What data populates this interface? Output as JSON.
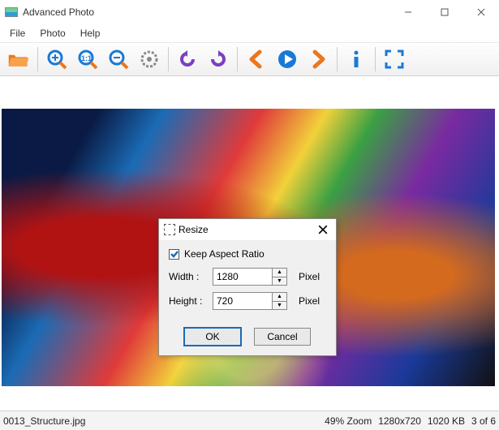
{
  "window": {
    "title": "Advanced Photo"
  },
  "menu": {
    "items": [
      "File",
      "Photo",
      "Help"
    ]
  },
  "toolbar": {
    "open": "open-folder",
    "zoom_in": "zoom-in",
    "zoom_actual": "zoom-actual",
    "zoom_out": "zoom-out",
    "zoom_fit": "zoom-fit",
    "rotate_ccw": "rotate-left",
    "rotate_cw": "rotate-right",
    "prev": "previous",
    "play": "play",
    "next": "next",
    "info": "info",
    "fullscreen": "fullscreen"
  },
  "colors": {
    "accent_blue": "#1a79d4",
    "accent_orange": "#eb771e",
    "accent_purple": "#7b3fbf"
  },
  "dialog": {
    "title": "Resize",
    "keep_ratio_label": "Keep Aspect Ratio",
    "keep_ratio_checked": true,
    "width_label": "Width :",
    "width_value": "1280",
    "width_unit": "Pixel",
    "height_label": "Height :",
    "height_value": "720",
    "height_unit": "Pixel",
    "ok_label": "OK",
    "cancel_label": "Cancel"
  },
  "status": {
    "filename": "0013_Structure.jpg",
    "zoom": "49% Zoom",
    "dimensions": "1280x720",
    "filesize": "1020 KB",
    "position": "3 of 6"
  }
}
